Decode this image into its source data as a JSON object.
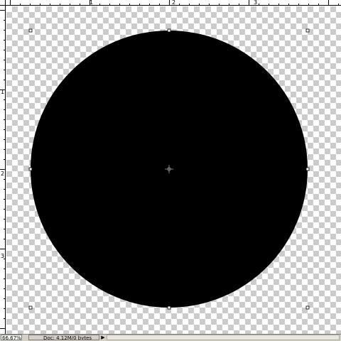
{
  "status_bar": {
    "zoom": "66.67%",
    "doc_info": "Doc: 4.12M/0 bytes",
    "menu_arrow_icon": "right-triangle-icon"
  },
  "rulers": {
    "top_numbers": [
      "1",
      "2",
      "3"
    ],
    "left_numbers": [
      "1",
      "2",
      "3"
    ]
  },
  "document": {
    "layer_shape": "filled-circle",
    "fill_color": "#000000",
    "transparency_pattern_colors": [
      "#ffffff",
      "#cccccc"
    ],
    "transform_handles": 8,
    "center_marker": "crosshair-icon"
  }
}
